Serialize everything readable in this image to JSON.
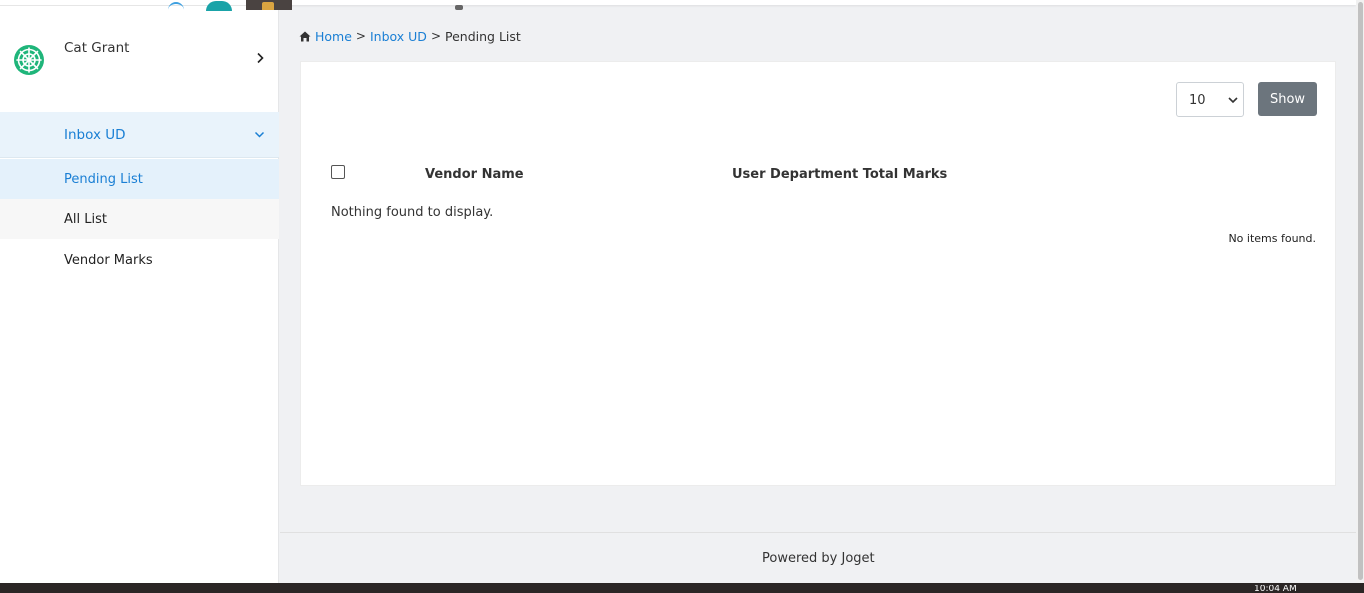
{
  "sidebar": {
    "profile": {
      "name": "Cat Grant",
      "avatar_icon": "snowflake-logo-icon",
      "avatar_color": "#1fb57a"
    },
    "menu_parent": {
      "label": "Inbox UD",
      "icon": "chevron-down-icon"
    },
    "items": [
      {
        "label": "Pending List",
        "active": true
      },
      {
        "label": "All List",
        "active": false
      },
      {
        "label": "Vendor Marks",
        "active": false
      }
    ]
  },
  "breadcrumb": {
    "home_icon": "home-icon",
    "items": [
      {
        "label": "Home"
      },
      {
        "label": "Inbox UD"
      },
      {
        "label": "Pending List"
      }
    ],
    "separator": ">"
  },
  "list": {
    "page_size": {
      "value": "10"
    },
    "show_label": "Show",
    "columns": [
      "Vendor Name",
      "User Department Total Marks"
    ],
    "empty_message": "Nothing found to display.",
    "no_items_message": "No items found."
  },
  "footer": {
    "text": "Powered by Joget"
  },
  "taskbar": {
    "clock": "10:04 AM"
  },
  "colors": {
    "accent": "#1a7fd4",
    "active_bg": "#e4f1fb",
    "show_button": "#6c757d",
    "background": "#f0f1f3"
  }
}
